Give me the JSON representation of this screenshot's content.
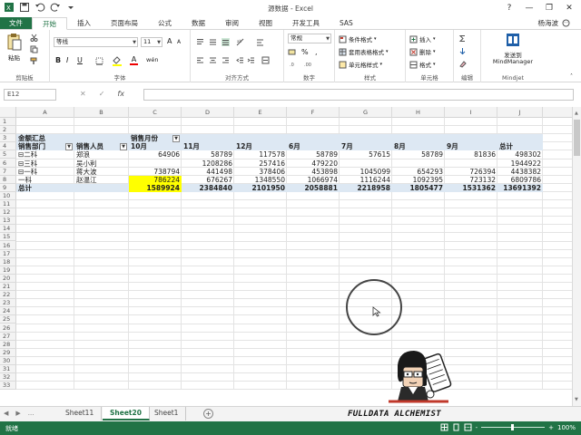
{
  "window": {
    "title": "源数据 - Excel",
    "controls": [
      "?",
      "—",
      "❐",
      "✕"
    ]
  },
  "qat": {
    "icons": [
      "excel-app-icon",
      "save-icon",
      "undo-icon",
      "redo-icon",
      "customize-qat-icon"
    ]
  },
  "ribbon_tabs": [
    {
      "label": "文件",
      "kind": "file"
    },
    {
      "label": "开始",
      "kind": "active"
    },
    {
      "label": "插入",
      "kind": ""
    },
    {
      "label": "页面布局",
      "kind": ""
    },
    {
      "label": "公式",
      "kind": ""
    },
    {
      "label": "数据",
      "kind": ""
    },
    {
      "label": "审阅",
      "kind": ""
    },
    {
      "label": "视图",
      "kind": ""
    },
    {
      "label": "开发工具",
      "kind": ""
    },
    {
      "label": "SAS",
      "kind": ""
    }
  ],
  "user": {
    "name": "杨海波"
  },
  "ribbon": {
    "clipboard": {
      "label": "剪贴板",
      "paste": "粘贴"
    },
    "font": {
      "label": "字体",
      "font_name": "等线",
      "font_size": "11",
      "bold": "B",
      "italic": "I",
      "underline": "U",
      "grow": "A",
      "shrink": "A",
      "font_color": "A",
      "wen": "wén"
    },
    "alignment": {
      "label": "对齐方式"
    },
    "number": {
      "label": "数字",
      "format": "常规",
      "percent": "%",
      "comma": ","
    },
    "styles": {
      "label": "样式",
      "conditional": "条件格式",
      "table": "套用表格格式",
      "cell": "单元格样式"
    },
    "cells": {
      "label": "单元格",
      "insert": "插入",
      "delete": "删除",
      "format": "格式"
    },
    "editing": {
      "label": "编辑"
    },
    "mindjet": {
      "label": "Mindjet",
      "button_line1": "发送到",
      "button_line2": "MindManager"
    }
  },
  "formula_bar": {
    "name_box": "E12",
    "fx": "fx",
    "cancel": "✕",
    "enter": "✓",
    "value": ""
  },
  "columns": [
    "A",
    "B",
    "C",
    "D",
    "E",
    "F",
    "G",
    "H",
    "I",
    "J"
  ],
  "rows": [
    "1",
    "2",
    "3",
    "4",
    "5",
    "6",
    "7",
    "8",
    "9",
    "10",
    "11",
    "12",
    "13",
    "14",
    "15",
    "16",
    "17",
    "18",
    "19",
    "20",
    "21",
    "22",
    "23",
    "24",
    "25",
    "26",
    "27",
    "28",
    "29",
    "30",
    "31",
    "32",
    "33"
  ],
  "pivot": {
    "r3": {
      "a": "金额汇总",
      "c": "销售月份"
    },
    "r4": [
      "销售部门",
      "销售人员",
      "10月",
      "11月",
      "12月",
      "6月",
      "7月",
      "8月",
      "9月",
      "总计"
    ],
    "body": [
      [
        "⊟二科",
        "郑浪",
        "64906",
        "58789",
        "117578",
        "58789",
        "57615",
        "58789",
        "81836",
        "498302"
      ],
      [
        "⊟三科",
        "吴小利",
        "",
        "1208286",
        "257416",
        "479220",
        "",
        "",
        "",
        "1944922"
      ],
      [
        "⊟一科",
        "蒋大波",
        "738794",
        "441498",
        "378406",
        "453898",
        "1045099",
        "654293",
        "726394",
        "4438382"
      ],
      [
        "一科",
        "赵温江",
        "786224",
        "676267",
        "1348550",
        "1066974",
        "1116244",
        "1092395",
        "723132",
        "6809786"
      ]
    ],
    "total": [
      "总计",
      "",
      "1589924",
      "2384840",
      "2101950",
      "2058881",
      "2218958",
      "1805477",
      "1531362",
      "13691392"
    ]
  },
  "sheets": [
    {
      "label": "Sheet11",
      "active": false
    },
    {
      "label": "Sheet20",
      "active": true
    },
    {
      "label": "Sheet1",
      "active": false
    }
  ],
  "sheet_nav": [
    "◀",
    "▶",
    "..."
  ],
  "add_sheet": "+",
  "brand": "FULLDATA ALCHEMIST",
  "status": {
    "ready": "就绪",
    "zoom": "100%",
    "minus": "-",
    "plus": "+"
  },
  "colors": {
    "accent": "#217346",
    "highlight": "#ffff00",
    "pivot_band": "#dde8f3"
  }
}
